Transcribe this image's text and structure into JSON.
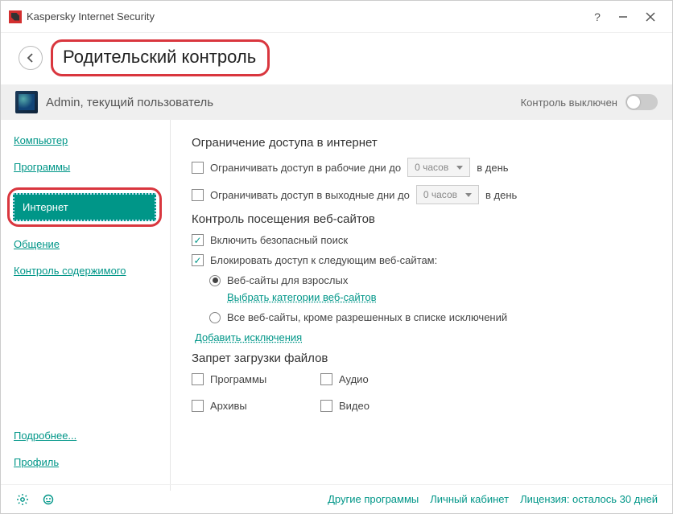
{
  "titlebar": {
    "app_title": "Kaspersky Internet Security"
  },
  "header": {
    "page_title": "Родительский контроль"
  },
  "user": {
    "name_label": "Admin, текущий пользователь",
    "toggle_label": "Контроль выключен"
  },
  "sidebar": {
    "items": [
      {
        "label": "Компьютер"
      },
      {
        "label": "Программы"
      },
      {
        "label": "Интернет"
      },
      {
        "label": "Общение"
      },
      {
        "label": "Контроль содержимого"
      }
    ],
    "more_label": "Подробнее...",
    "profile_label": "Профиль"
  },
  "content": {
    "sect1_title": "Ограничение доступа в интернет",
    "limit_weekday_label": "Ограничивать доступ в рабочие дни до",
    "limit_weekend_label": "Ограничивать доступ в выходные дни до",
    "hours_value": "0 часов",
    "per_day_label": "в день",
    "sect2_title": "Контроль посещения веб-сайтов",
    "safe_search_label": "Включить безопасный поиск",
    "block_sites_label": "Блокировать доступ к следующим веб-сайтам:",
    "radio_adult_label": "Веб-сайты для взрослых",
    "categories_link": "Выбрать категории веб-сайтов",
    "radio_all_label": "Все веб-сайты, кроме разрешенных в списке исключений",
    "exclusions_link": "Добавить исключения",
    "sect3_title": "Запрет загрузки файлов",
    "dl_programs": "Программы",
    "dl_audio": "Аудио",
    "dl_archives": "Архивы",
    "dl_video": "Видео"
  },
  "footer": {
    "other_programs": "Другие программы",
    "cabinet": "Личный кабинет",
    "license": "Лицензия: осталось 30 дней"
  }
}
